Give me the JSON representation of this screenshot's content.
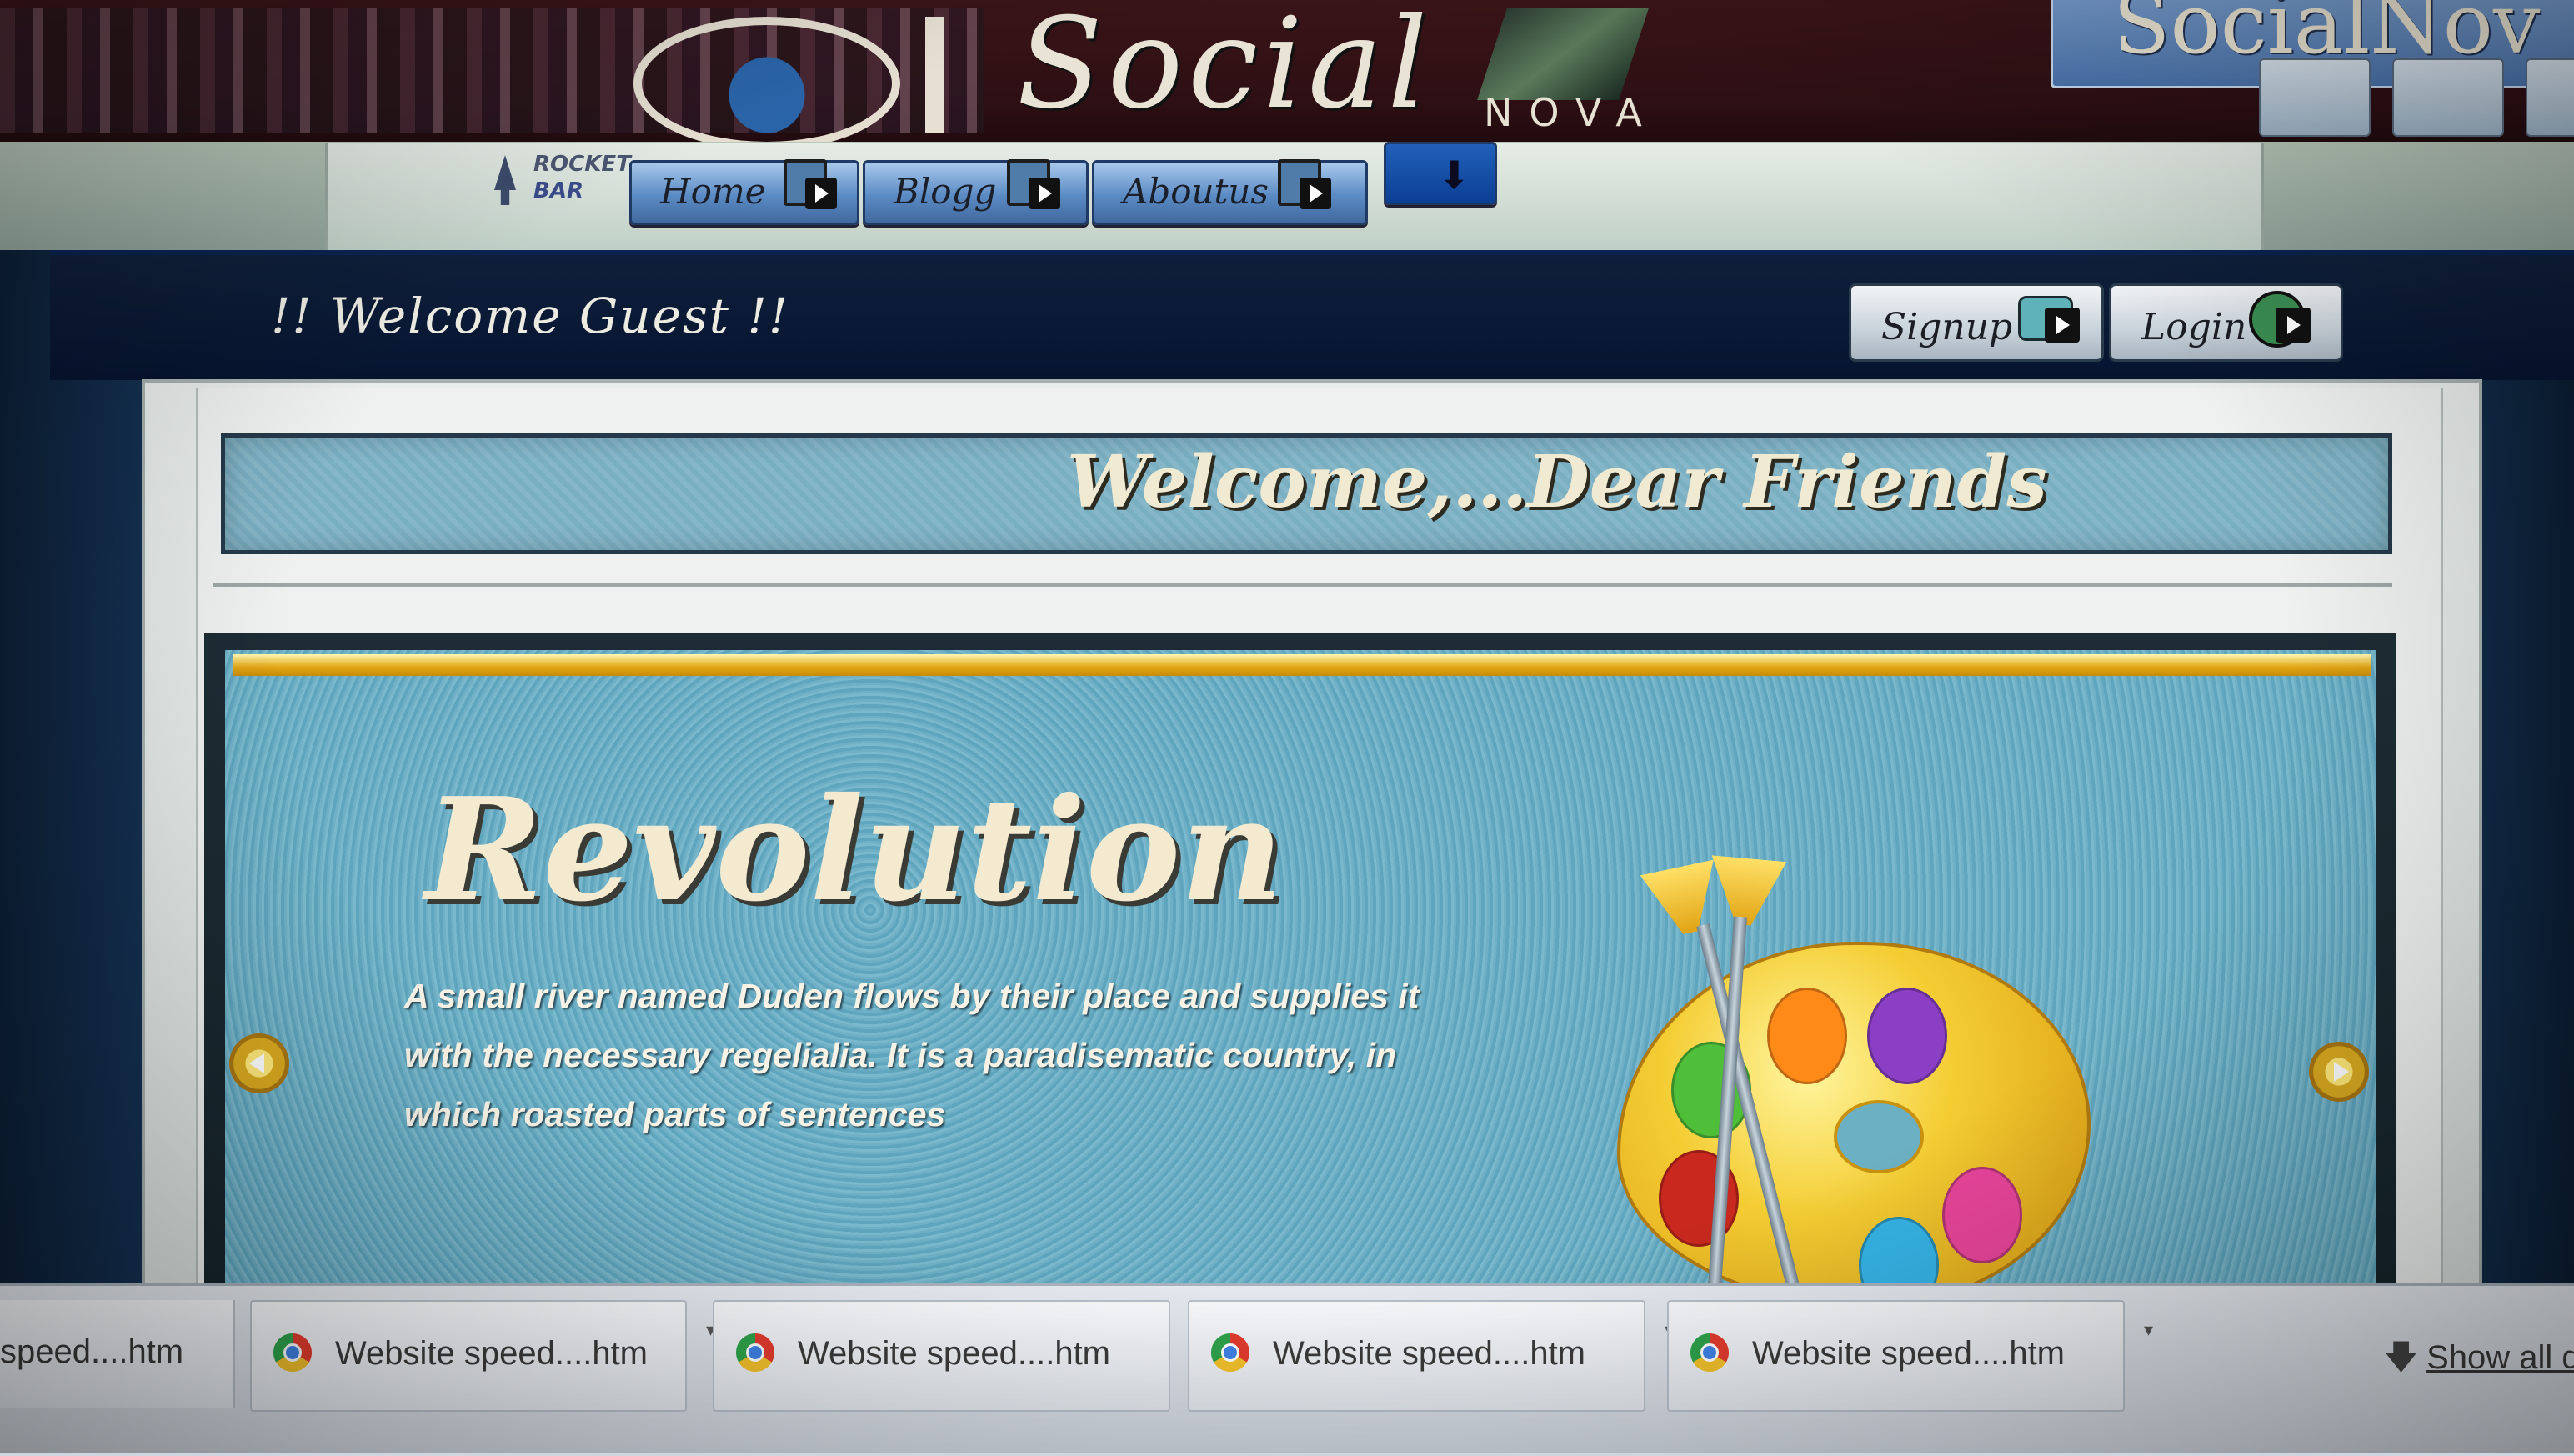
{
  "header": {
    "brand_title": "Social",
    "brand_subtitle": "NOVA",
    "corner_title": "SocialNov"
  },
  "nav": {
    "rocket_bar_line1": "ROCKET",
    "rocket_bar_line2": "BAR",
    "items": [
      {
        "label": "Home",
        "icon": "home-icon"
      },
      {
        "label": "Blogg",
        "icon": "blog-icon"
      },
      {
        "label": "Aboutus",
        "icon": "about-icon"
      }
    ],
    "download_icon": "arrow-down-icon"
  },
  "welcome": {
    "guest_text": "!! Welcome Guest !!",
    "signup_label": "Signup",
    "login_label": "Login"
  },
  "banner": {
    "title": "Welcome,...Dear Friends"
  },
  "slide": {
    "title": "Revolution",
    "text": "A small river named Duden flows by their place and supplies it with the necessary regelialia. It is a paradisematic country, in which roasted parts of sentences",
    "image_icon": "paint-palette-icon"
  },
  "downloads": {
    "partial_item": "speed....htm",
    "items": [
      {
        "name": "Website speed....htm"
      },
      {
        "name": "Website speed....htm"
      },
      {
        "name": "Website speed....htm"
      },
      {
        "name": "Website speed....htm"
      }
    ],
    "show_all": "Show all d"
  },
  "colors": {
    "header_bg": "#2d0f13",
    "nav_button": "#5b8bc4",
    "slide_bg": "#6fb0c6",
    "accent_gold": "#e2a514",
    "frame_blue": "#1d4370"
  }
}
